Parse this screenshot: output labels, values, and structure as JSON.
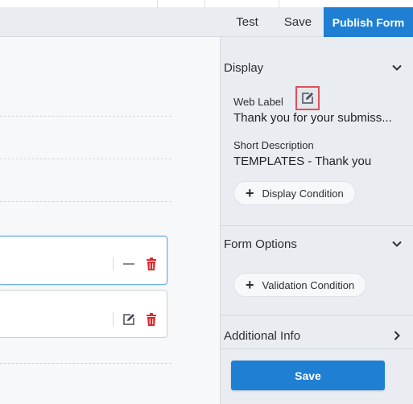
{
  "toolbar": {
    "test_label": "Test",
    "save_label": "Save",
    "publish_label": "Publish Form"
  },
  "panel": {
    "display": {
      "title": "Display",
      "web_label_caption": "Web Label",
      "web_label_value": "Thank you for your submiss...",
      "short_desc_caption": "Short Description",
      "short_desc_value": "TEMPLATES - Thank you",
      "condition_button": "Display Condition"
    },
    "form_options": {
      "title": "Form Options",
      "condition_button": "Validation Condition"
    },
    "additional_info": {
      "title": "Additional Info"
    },
    "save_label": "Save"
  },
  "colors": {
    "accent": "#1f7fd3",
    "delete": "#e0262c",
    "highlight": "#e05058",
    "panel_bg": "#e9edf2"
  }
}
